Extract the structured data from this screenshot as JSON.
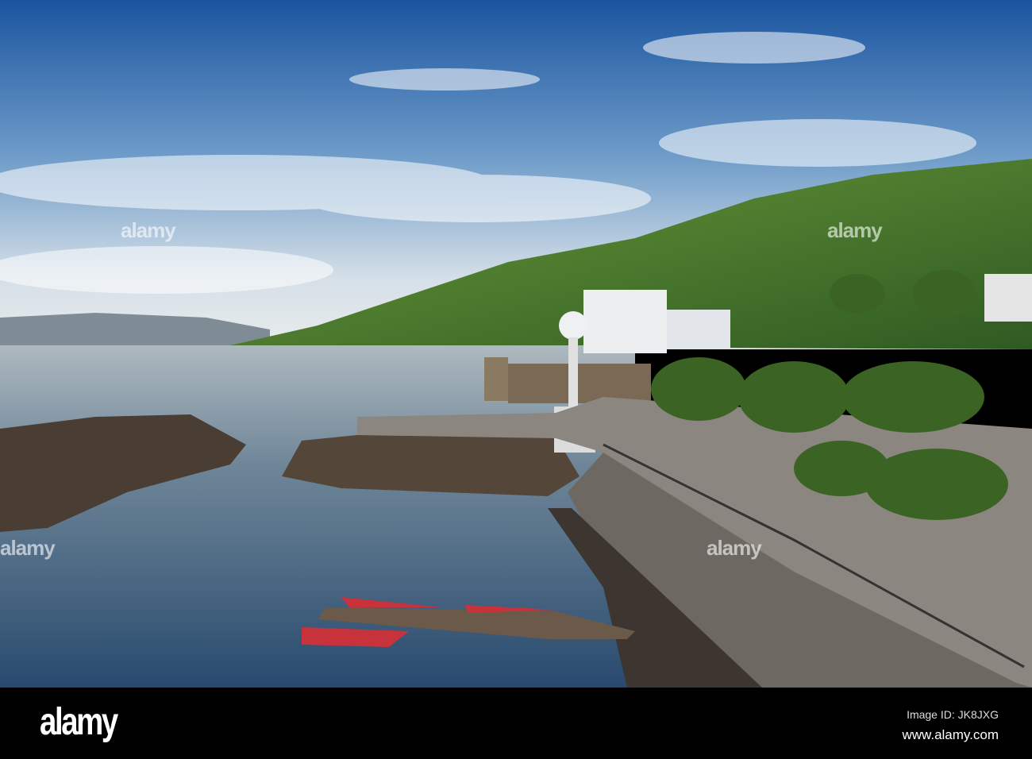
{
  "photo": {
    "subject": "Lakeside promenade with hills",
    "colors": {
      "sky_top": "#1d5aa6",
      "sky_horizon": "#dfe6ea",
      "hill": "#4f7d2c",
      "water": "#5d7890",
      "promenade": "#8b8780",
      "rocks": "#4a3d34",
      "boat": "#c8323a"
    }
  },
  "watermark": {
    "text": "alamy"
  },
  "footer": {
    "logo": "alamy",
    "image_id": "Image ID: JK8JXG",
    "website": "www.alamy.com"
  }
}
